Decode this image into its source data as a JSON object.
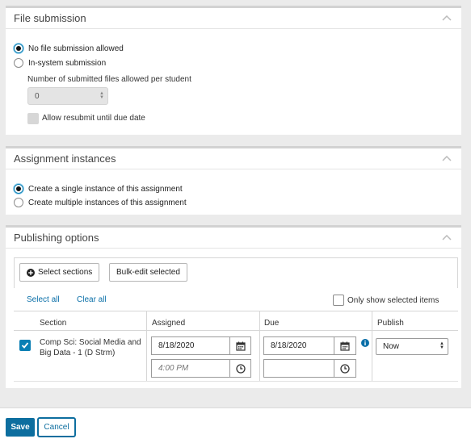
{
  "file_submission": {
    "title": "File submission",
    "options": [
      {
        "label": "No file submission allowed",
        "checked": true
      },
      {
        "label": "In-system submission",
        "checked": false
      }
    ],
    "files_label": "Number of submitted files allowed per student",
    "files_value": "0",
    "resubmit_label": "Allow resubmit until due date"
  },
  "assignment_instances": {
    "title": "Assignment instances",
    "options": [
      {
        "label": "Create a single instance of this assignment",
        "checked": true
      },
      {
        "label": "Create multiple instances of this assignment",
        "checked": false
      }
    ]
  },
  "publishing": {
    "title": "Publishing options",
    "select_sections": "Select sections",
    "bulk_edit": "Bulk-edit selected",
    "select_all": "Select all",
    "clear_all": "Clear all",
    "only_show": "Only show selected items",
    "columns": {
      "section": "Section",
      "assigned": "Assigned",
      "due": "Due",
      "publish": "Publish"
    },
    "rows": [
      {
        "section_line1": "Comp Sci: Social Media and",
        "section_line2": "Big Data - 1 (D Strm)",
        "assigned_date": "8/18/2020",
        "assigned_time_placeholder": "4:00 PM",
        "due_date": "8/18/2020",
        "due_time": "",
        "publish": "Now"
      }
    ]
  },
  "footer": {
    "save": "Save",
    "cancel": "Cancel"
  },
  "colors": {
    "accent": "#0d6e9f",
    "checkbox": "#0a7fb4",
    "link": "#0a6fa8"
  }
}
